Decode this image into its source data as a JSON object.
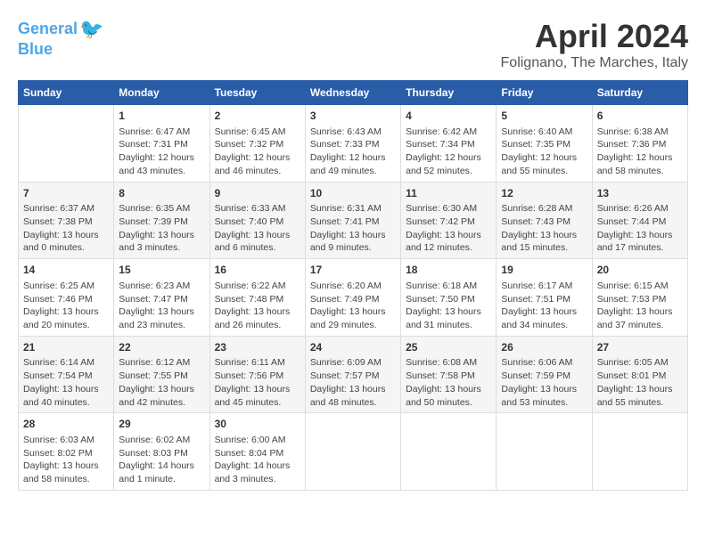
{
  "logo": {
    "line1": "General",
    "line2": "Blue"
  },
  "title": "April 2024",
  "subtitle": "Folignano, The Marches, Italy",
  "headers": [
    "Sunday",
    "Monday",
    "Tuesday",
    "Wednesday",
    "Thursday",
    "Friday",
    "Saturday"
  ],
  "weeks": [
    [
      {
        "day": "",
        "content": ""
      },
      {
        "day": "1",
        "content": "Sunrise: 6:47 AM\nSunset: 7:31 PM\nDaylight: 12 hours\nand 43 minutes."
      },
      {
        "day": "2",
        "content": "Sunrise: 6:45 AM\nSunset: 7:32 PM\nDaylight: 12 hours\nand 46 minutes."
      },
      {
        "day": "3",
        "content": "Sunrise: 6:43 AM\nSunset: 7:33 PM\nDaylight: 12 hours\nand 49 minutes."
      },
      {
        "day": "4",
        "content": "Sunrise: 6:42 AM\nSunset: 7:34 PM\nDaylight: 12 hours\nand 52 minutes."
      },
      {
        "day": "5",
        "content": "Sunrise: 6:40 AM\nSunset: 7:35 PM\nDaylight: 12 hours\nand 55 minutes."
      },
      {
        "day": "6",
        "content": "Sunrise: 6:38 AM\nSunset: 7:36 PM\nDaylight: 12 hours\nand 58 minutes."
      }
    ],
    [
      {
        "day": "7",
        "content": "Sunrise: 6:37 AM\nSunset: 7:38 PM\nDaylight: 13 hours\nand 0 minutes."
      },
      {
        "day": "8",
        "content": "Sunrise: 6:35 AM\nSunset: 7:39 PM\nDaylight: 13 hours\nand 3 minutes."
      },
      {
        "day": "9",
        "content": "Sunrise: 6:33 AM\nSunset: 7:40 PM\nDaylight: 13 hours\nand 6 minutes."
      },
      {
        "day": "10",
        "content": "Sunrise: 6:31 AM\nSunset: 7:41 PM\nDaylight: 13 hours\nand 9 minutes."
      },
      {
        "day": "11",
        "content": "Sunrise: 6:30 AM\nSunset: 7:42 PM\nDaylight: 13 hours\nand 12 minutes."
      },
      {
        "day": "12",
        "content": "Sunrise: 6:28 AM\nSunset: 7:43 PM\nDaylight: 13 hours\nand 15 minutes."
      },
      {
        "day": "13",
        "content": "Sunrise: 6:26 AM\nSunset: 7:44 PM\nDaylight: 13 hours\nand 17 minutes."
      }
    ],
    [
      {
        "day": "14",
        "content": "Sunrise: 6:25 AM\nSunset: 7:46 PM\nDaylight: 13 hours\nand 20 minutes."
      },
      {
        "day": "15",
        "content": "Sunrise: 6:23 AM\nSunset: 7:47 PM\nDaylight: 13 hours\nand 23 minutes."
      },
      {
        "day": "16",
        "content": "Sunrise: 6:22 AM\nSunset: 7:48 PM\nDaylight: 13 hours\nand 26 minutes."
      },
      {
        "day": "17",
        "content": "Sunrise: 6:20 AM\nSunset: 7:49 PM\nDaylight: 13 hours\nand 29 minutes."
      },
      {
        "day": "18",
        "content": "Sunrise: 6:18 AM\nSunset: 7:50 PM\nDaylight: 13 hours\nand 31 minutes."
      },
      {
        "day": "19",
        "content": "Sunrise: 6:17 AM\nSunset: 7:51 PM\nDaylight: 13 hours\nand 34 minutes."
      },
      {
        "day": "20",
        "content": "Sunrise: 6:15 AM\nSunset: 7:53 PM\nDaylight: 13 hours\nand 37 minutes."
      }
    ],
    [
      {
        "day": "21",
        "content": "Sunrise: 6:14 AM\nSunset: 7:54 PM\nDaylight: 13 hours\nand 40 minutes."
      },
      {
        "day": "22",
        "content": "Sunrise: 6:12 AM\nSunset: 7:55 PM\nDaylight: 13 hours\nand 42 minutes."
      },
      {
        "day": "23",
        "content": "Sunrise: 6:11 AM\nSunset: 7:56 PM\nDaylight: 13 hours\nand 45 minutes."
      },
      {
        "day": "24",
        "content": "Sunrise: 6:09 AM\nSunset: 7:57 PM\nDaylight: 13 hours\nand 48 minutes."
      },
      {
        "day": "25",
        "content": "Sunrise: 6:08 AM\nSunset: 7:58 PM\nDaylight: 13 hours\nand 50 minutes."
      },
      {
        "day": "26",
        "content": "Sunrise: 6:06 AM\nSunset: 7:59 PM\nDaylight: 13 hours\nand 53 minutes."
      },
      {
        "day": "27",
        "content": "Sunrise: 6:05 AM\nSunset: 8:01 PM\nDaylight: 13 hours\nand 55 minutes."
      }
    ],
    [
      {
        "day": "28",
        "content": "Sunrise: 6:03 AM\nSunset: 8:02 PM\nDaylight: 13 hours\nand 58 minutes."
      },
      {
        "day": "29",
        "content": "Sunrise: 6:02 AM\nSunset: 8:03 PM\nDaylight: 14 hours\nand 1 minute."
      },
      {
        "day": "30",
        "content": "Sunrise: 6:00 AM\nSunset: 8:04 PM\nDaylight: 14 hours\nand 3 minutes."
      },
      {
        "day": "",
        "content": ""
      },
      {
        "day": "",
        "content": ""
      },
      {
        "day": "",
        "content": ""
      },
      {
        "day": "",
        "content": ""
      }
    ]
  ],
  "accent_color": "#2a5da8"
}
